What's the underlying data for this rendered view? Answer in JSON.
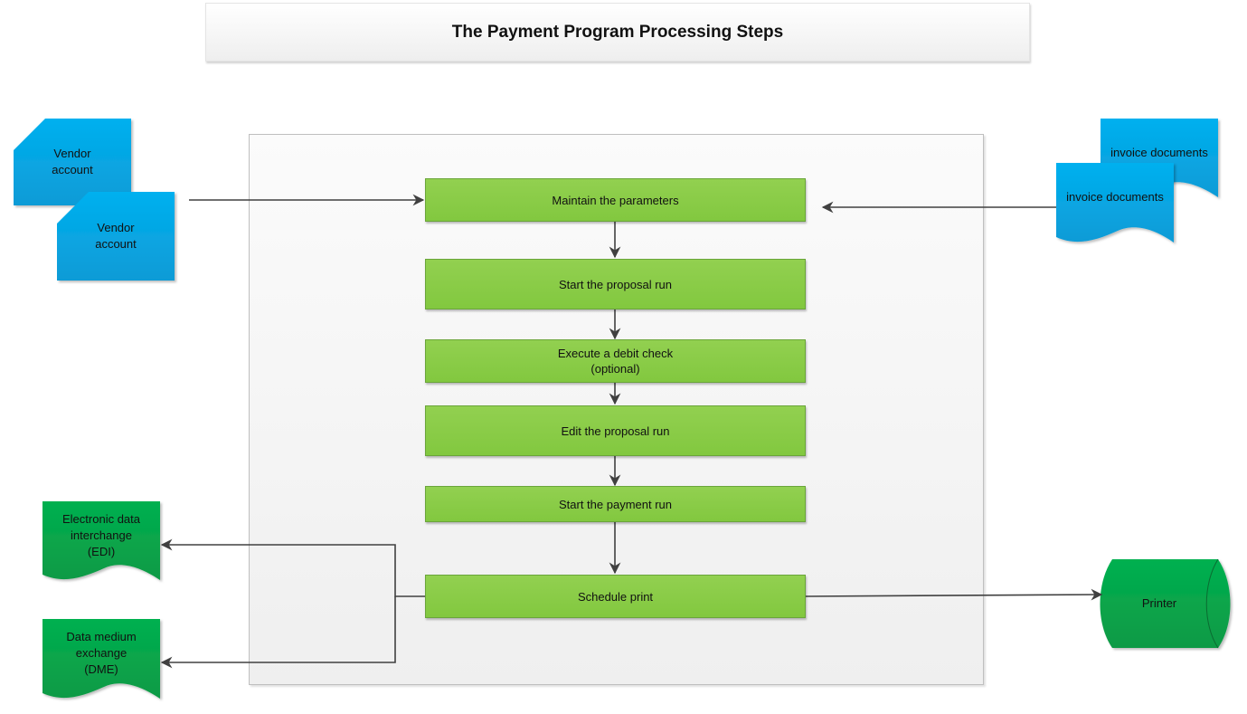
{
  "title": "The Payment Program Processing Steps",
  "inputs": {
    "vendor_accounts": [
      "Vendor\naccount",
      "Vendor\naccount"
    ],
    "invoice_documents": [
      "invoice documents",
      "invoice documents"
    ]
  },
  "steps": [
    {
      "label": "Maintain the parameters"
    },
    {
      "label": "Start the proposal run"
    },
    {
      "label": "Execute a debit check\n(optional)"
    },
    {
      "label": "Edit the proposal run"
    },
    {
      "label": "Start the payment run"
    },
    {
      "label": "Schedule print"
    }
  ],
  "outputs": {
    "edi": "Electronic data\ninterchange\n(EDI)",
    "dme": "Data medium\nexchange\n(DME)",
    "printer": "Printer"
  },
  "colors": {
    "input_blue": "#00aeef",
    "step_green": "#8cce4a",
    "output_green": "#00a651",
    "connector": "#404040"
  }
}
